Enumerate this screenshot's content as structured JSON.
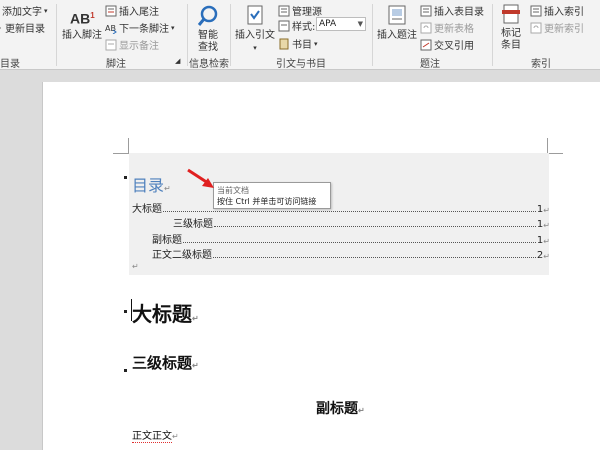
{
  "ribbon": {
    "toc_group": {
      "add_text": "添加文字",
      "update_toc": "更新目录",
      "label": "目录"
    },
    "footnote_group": {
      "insert_footnote": "插入脚注",
      "insert_endnote": "插入尾注",
      "next_footnote": "下一条脚注",
      "show_notes": "显示备注",
      "label": "脚注",
      "ab_glyph": "AB",
      "ab_superscript": "1"
    },
    "research_group": {
      "smart_lookup": "智能查找",
      "smart_lookup_line1": "智能",
      "smart_lookup_line2": "查找",
      "label": "信息检索"
    },
    "citations_group": {
      "insert_citation": "插入引文",
      "manage_sources": "管理源",
      "style_label": "样式:",
      "style_value": "APA",
      "bibliography": "书目",
      "label": "引文与书目"
    },
    "captions_group": {
      "insert_caption": "插入题注",
      "insert_table_of_figures": "插入表目录",
      "update_table": "更新表格",
      "cross_reference": "交叉引用",
      "label": "题注"
    },
    "index_group": {
      "mark_entry_line1": "标记",
      "mark_entry_line2": "条目",
      "insert_index": "插入索引",
      "update_index": "更新索引",
      "label": "索引"
    }
  },
  "document": {
    "toc_title": "目录",
    "toc_entries": [
      {
        "text": "大标题",
        "page": "1"
      },
      {
        "text": "三级标题",
        "page": "1"
      },
      {
        "text": "副标题",
        "page": "1"
      },
      {
        "text": "正文二级标题",
        "page": "2"
      }
    ],
    "tooltip": {
      "line1": "当前文档",
      "line2": "按住 Ctrl 并单击可访问链接"
    },
    "heading1": "大标题",
    "heading3": "三级标题",
    "subtitle": "副标题",
    "body_text": "正文正文",
    "para_mark": "↵"
  },
  "colors": {
    "toc_title": "#4f81bd",
    "arrow": "#e02020",
    "field_shading": "#f0f0f0"
  },
  "icons": [
    "add-text-icon",
    "update-toc-icon",
    "insert-footnote-icon",
    "insert-endnote-icon",
    "next-footnote-icon",
    "show-notes-icon",
    "smart-lookup-icon",
    "insert-citation-icon",
    "manage-sources-icon",
    "style-icon",
    "bibliography-icon",
    "insert-caption-icon",
    "table-of-figures-icon",
    "update-table-icon",
    "cross-reference-icon",
    "mark-entry-icon",
    "insert-index-icon",
    "update-index-icon",
    "pointer-arrow-icon"
  ]
}
